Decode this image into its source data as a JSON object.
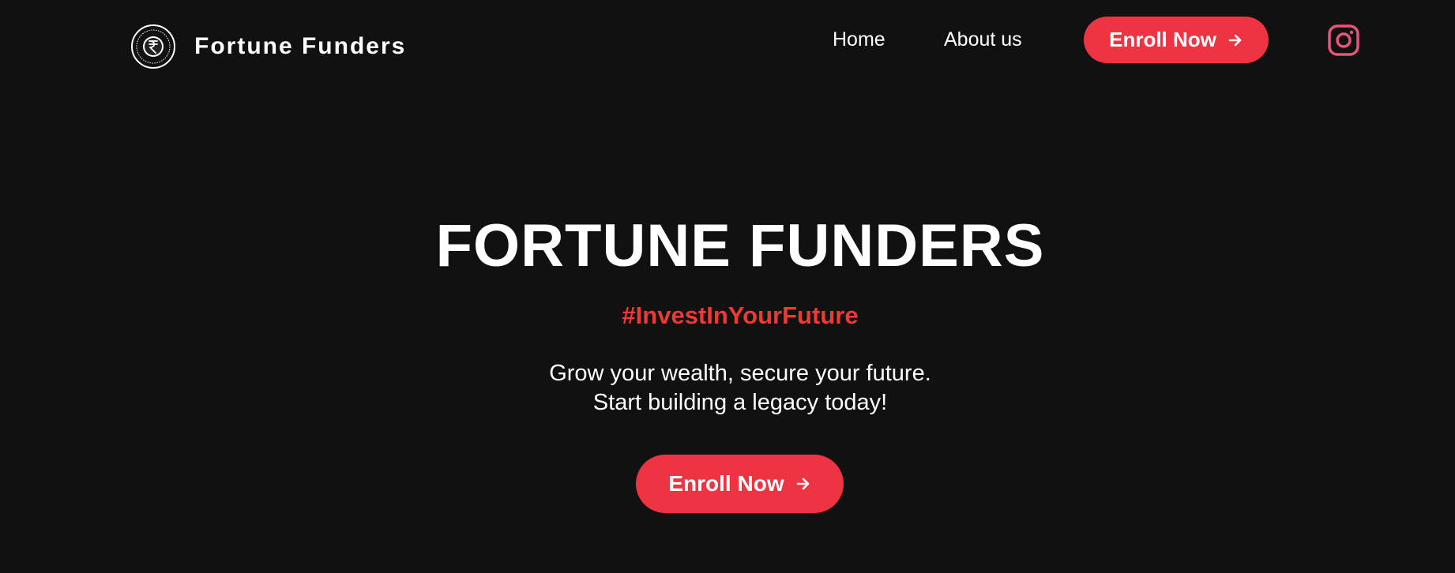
{
  "header": {
    "brand_name": "Fortune Funders",
    "logo_icon": "rupee-coin-logo-icon",
    "nav": [
      {
        "label": "Home"
      },
      {
        "label": "About us"
      }
    ],
    "enroll_label": "Enroll Now",
    "instagram_icon": "instagram-icon"
  },
  "hero": {
    "title": "FORTUNE FUNDERS",
    "tagline": "#InvestInYourFuture",
    "line1": "Grow your wealth, secure your future.",
    "line2": "Start building a legacy today!",
    "enroll_label": "Enroll Now"
  },
  "colors": {
    "background": "#111111",
    "accent": "#ee3342",
    "tagline": "#ee3a35",
    "text": "#ffffff",
    "instagram": "#e8557a"
  }
}
